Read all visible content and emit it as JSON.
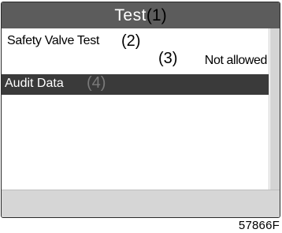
{
  "header": {
    "title": "Test",
    "title_callout": "(1)"
  },
  "menu": {
    "items": [
      {
        "label": "Safety Valve Test",
        "callout": "(2)",
        "status_callout": "(3)",
        "status": "Not allowed",
        "selected": false
      },
      {
        "label": "Audit Data",
        "callout": "(4)",
        "selected": true
      }
    ]
  },
  "figure_id": "57866F",
  "colors": {
    "title_bar": "#5c5c5c",
    "selected_row": "#3a3a3a",
    "bottom_bar": "#d6d6d6",
    "scrollbar": "#d4d4d4"
  },
  "icons": {
    "scrollbar": "vertical-scrollbar"
  }
}
